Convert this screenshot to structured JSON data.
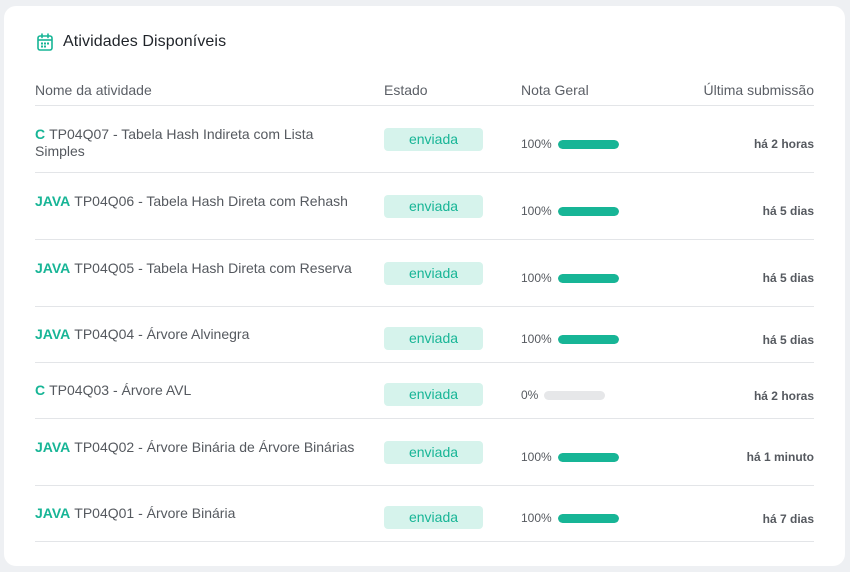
{
  "card": {
    "title": "Atividades Disponíveis",
    "icon": "calendar-icon"
  },
  "columns": {
    "name": "Nome da atividade",
    "state": "Estado",
    "grade": "Nota Geral",
    "last": "Última submissão"
  },
  "colors": {
    "accent": "#17b596",
    "badge_bg": "#d6f3ec",
    "track": "#e6e7e9"
  },
  "activities": [
    {
      "lang": "C",
      "title": "TP04Q07 - Tabela Hash Indireta com Lista Simples",
      "state": "enviada",
      "grade_label": "100%",
      "grade": 1.0,
      "last": "há 2 horas"
    },
    {
      "lang": "JAVA",
      "title": "TP04Q06 - Tabela Hash Direta com Rehash",
      "state": "enviada",
      "grade_label": "100%",
      "grade": 1.0,
      "last": "há 5 dias"
    },
    {
      "lang": "JAVA",
      "title": "TP04Q05 - Tabela Hash Direta com Reserva",
      "state": "enviada",
      "grade_label": "100%",
      "grade": 1.0,
      "last": "há 5 dias"
    },
    {
      "lang": "JAVA",
      "title": "TP04Q04 - Árvore Alvinegra",
      "state": "enviada",
      "grade_label": "100%",
      "grade": 1.0,
      "last": "há 5 dias"
    },
    {
      "lang": "C",
      "title": "TP04Q03 - Árvore AVL",
      "state": "enviada",
      "grade_label": "0%",
      "grade": 0.0,
      "last": "há 2 horas"
    },
    {
      "lang": "JAVA",
      "title": "TP04Q02 - Árvore Binária de Árvore Binárias",
      "state": "enviada",
      "grade_label": "100%",
      "grade": 1.0,
      "last": "há 1 minuto"
    },
    {
      "lang": "JAVA",
      "title": "TP04Q01 - Árvore Binária",
      "state": "enviada",
      "grade_label": "100%",
      "grade": 1.0,
      "last": "há 7 dias"
    }
  ]
}
